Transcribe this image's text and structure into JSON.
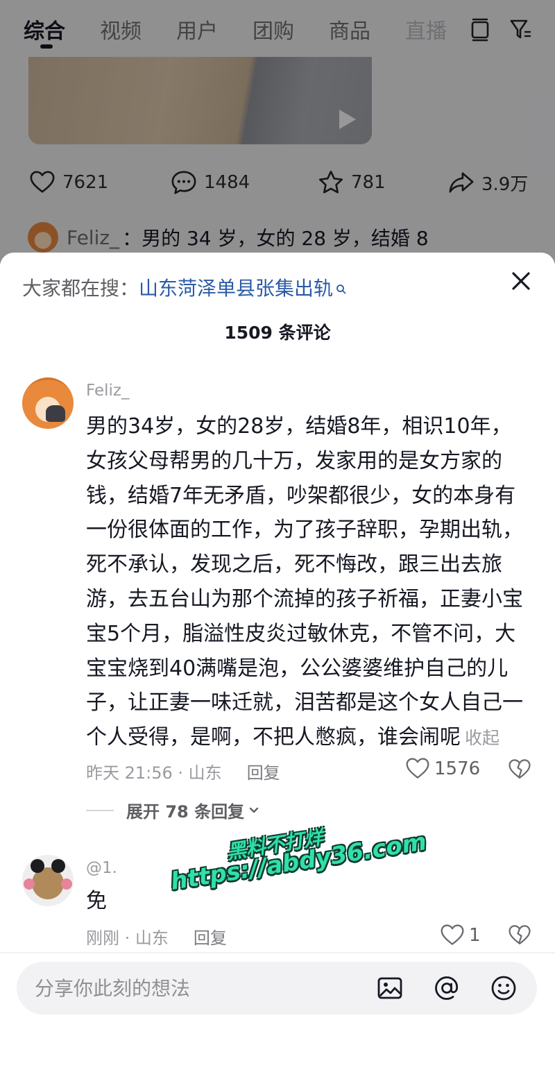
{
  "header": {
    "tabs": [
      "综合",
      "视频",
      "用户",
      "团购",
      "商品",
      "直播"
    ],
    "active_tab": "综合"
  },
  "post": {
    "likes": "7621",
    "comments": "1484",
    "favorites": "781",
    "shares": "3.9万",
    "preview_user": "Feliz_",
    "preview_text": "：男的 34 岁，女的 28 岁，结婚 8"
  },
  "sheet": {
    "search_label": "大家都在搜：",
    "search_term": "山东菏泽单县张集出轨",
    "comment_count": "1509 条评论",
    "comments": [
      {
        "user": "Feliz_",
        "text": "男的34岁，女的28岁，结婚8年，相识10年，女孩父母帮男的几十万，发家用的是女方家的钱，结婚7年无矛盾，吵架都很少，女的本身有一份很体面的工作，为了孩子辞职，孕期出轨，死不承认，发现之后，死不悔改，跟三出去旅游，去五台山为那个流掉的孩子祈福，正妻小宝宝5个月，脂溢性皮炎过敏休克，不管不问，大宝宝烧到40满嘴是泡，公公婆婆维护自己的儿子，让正妻一味迁就，泪苦都是这个女人自己一个人受得，是啊，不把人憋疯，谁会闹呢",
        "collapse_label": "收起",
        "time_location": "昨天 21:56 · 山东",
        "reply_label": "回复",
        "likes": "1576",
        "expand_label": "展开 78 条回复"
      },
      {
        "user": "@1.",
        "text": "免",
        "time_location": "刚刚 · 山东",
        "reply_label": "回复",
        "likes": "1"
      }
    ]
  },
  "watermark": {
    "line1": "黑料不打烊",
    "line2": "https://abdy36.com"
  },
  "input": {
    "placeholder": "分享你此刻的想法"
  },
  "colors": {
    "link_blue": "#2a5aa6",
    "watermark_green": "#2fe0a8"
  }
}
